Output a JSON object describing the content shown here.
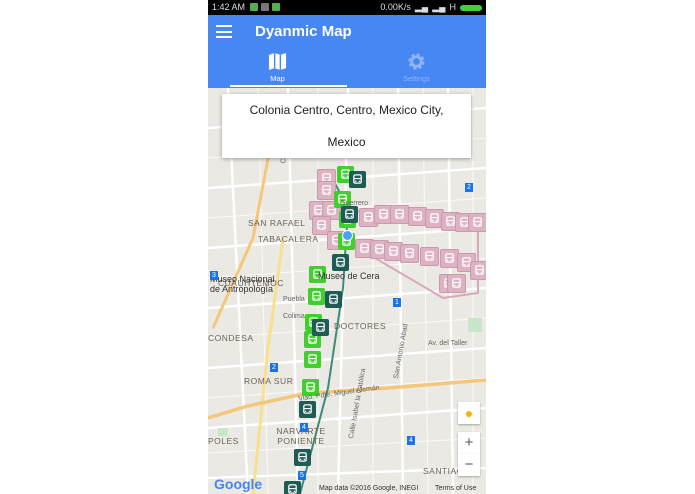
{
  "status_bar": {
    "time": "1:42 AM",
    "network_speed": "0.00K/s",
    "network_type": "H"
  },
  "app_bar": {
    "title": "Dyanmic Map",
    "menu_icon": "hamburger-menu-icon"
  },
  "tabs": [
    {
      "label": "Map",
      "icon": "map-icon",
      "active": true
    },
    {
      "label": "Settings",
      "icon": "gear-icon",
      "active": false
    }
  ],
  "address_card": {
    "line1": "Colonia Centro, Centro, Mexico City,",
    "line2": "Mexico"
  },
  "map": {
    "neighborhoods": [
      "SAN RAFAEL",
      "TABACALERA",
      "CUAUHTÉMOC",
      "ROMA SUR",
      "NARVARTE PONIENTE",
      "DOCTORES",
      "CONDESA",
      "SANTIAGO",
      "POLES"
    ],
    "places": [
      "Museo Nacional de Antropología",
      "Museo de Cera"
    ],
    "streets": [
      "Viad. Pdte. Miguel Alemán",
      "Calle Isabel la Católica",
      "San Antonio Abad",
      "Av. del Taller",
      "Puebla",
      "Colima",
      "Guerrero",
      "Cedro"
    ],
    "metro_lines": [
      "1",
      "2",
      "3",
      "4",
      "5"
    ],
    "zoom_in": "+",
    "zoom_out": "−",
    "google_logo": "Google",
    "attribution": "Map data ©2016 Google, INEGI",
    "terms": "Terms of Use"
  },
  "colors": {
    "app_bar": "#4687f4",
    "bus_marker": "#40cf2c",
    "metro_marker": "#1f5c56",
    "other_marker": "#ddb2c2"
  }
}
